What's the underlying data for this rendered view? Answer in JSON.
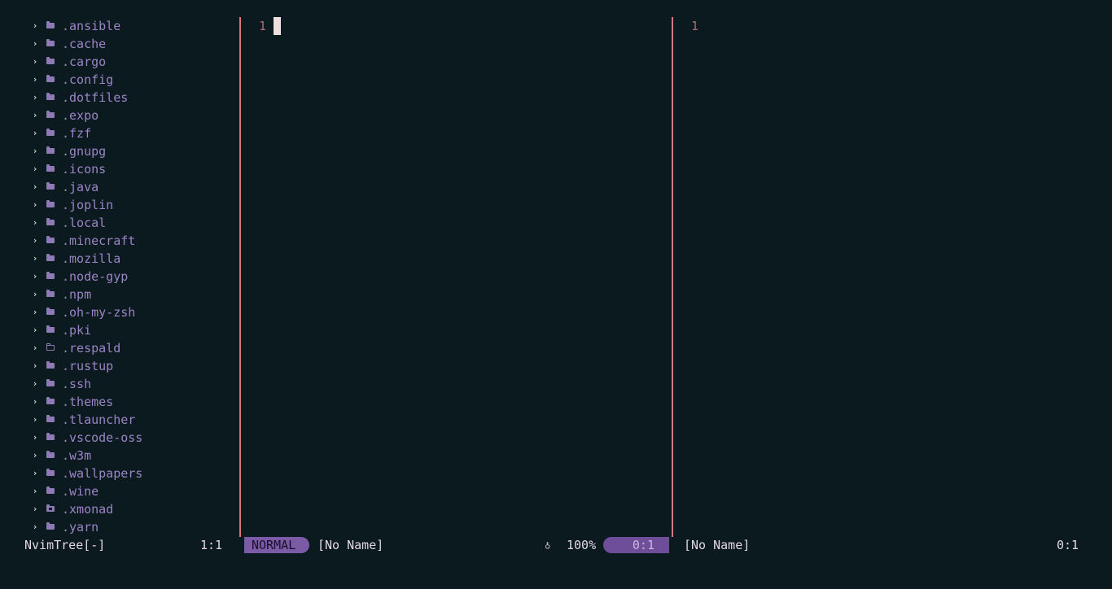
{
  "tree": {
    "items": [
      {
        "name": ".ansible",
        "icon": "folder-icon"
      },
      {
        "name": ".cache",
        "icon": "folder-icon"
      },
      {
        "name": ".cargo",
        "icon": "folder-icon"
      },
      {
        "name": ".config",
        "icon": "folder-icon"
      },
      {
        "name": ".dotfiles",
        "icon": "folder-icon"
      },
      {
        "name": ".expo",
        "icon": "folder-icon"
      },
      {
        "name": ".fzf",
        "icon": "folder-icon"
      },
      {
        "name": ".gnupg",
        "icon": "folder-icon"
      },
      {
        "name": ".icons",
        "icon": "folder-icon"
      },
      {
        "name": ".java",
        "icon": "folder-icon"
      },
      {
        "name": ".joplin",
        "icon": "folder-icon"
      },
      {
        "name": ".local",
        "icon": "folder-icon"
      },
      {
        "name": ".minecraft",
        "icon": "folder-icon"
      },
      {
        "name": ".mozilla",
        "icon": "folder-icon"
      },
      {
        "name": ".node-gyp",
        "icon": "folder-icon"
      },
      {
        "name": ".npm",
        "icon": "folder-icon"
      },
      {
        "name": ".oh-my-zsh",
        "icon": "folder-icon"
      },
      {
        "name": ".pki",
        "icon": "folder-icon"
      },
      {
        "name": ".respald",
        "icon": "empty-folder-icon"
      },
      {
        "name": ".rustup",
        "icon": "folder-icon"
      },
      {
        "name": ".ssh",
        "icon": "folder-icon"
      },
      {
        "name": ".themes",
        "icon": "folder-icon"
      },
      {
        "name": ".tlauncher",
        "icon": "folder-icon"
      },
      {
        "name": ".vscode-oss",
        "icon": "folder-icon"
      },
      {
        "name": ".w3m",
        "icon": "folder-icon"
      },
      {
        "name": ".wallpapers",
        "icon": "folder-icon"
      },
      {
        "name": ".wine",
        "icon": "folder-icon"
      },
      {
        "name": ".xmonad",
        "icon": "git-folder-icon"
      },
      {
        "name": ".yarn",
        "icon": "folder-icon"
      }
    ],
    "chevron": "›"
  },
  "left_buffer": {
    "line_number": "1"
  },
  "right_buffer": {
    "line_number": "1"
  },
  "statusline": {
    "tree_name": "NvimTree[-]",
    "tree_pos": "1:1",
    "mode": "NORMAL",
    "left_file": "[No Name]",
    "flame_glyph": "♁",
    "percent": "100%",
    "left_pos": "0:1",
    "right_file": "[No Name]",
    "right_pos": "0:1"
  },
  "colors": {
    "background": "#0a1a1e",
    "folder": "#9d84c9",
    "separator": "#d9757f",
    "mode_bg": "#7b5aa6",
    "line_number": "#a86d78"
  }
}
